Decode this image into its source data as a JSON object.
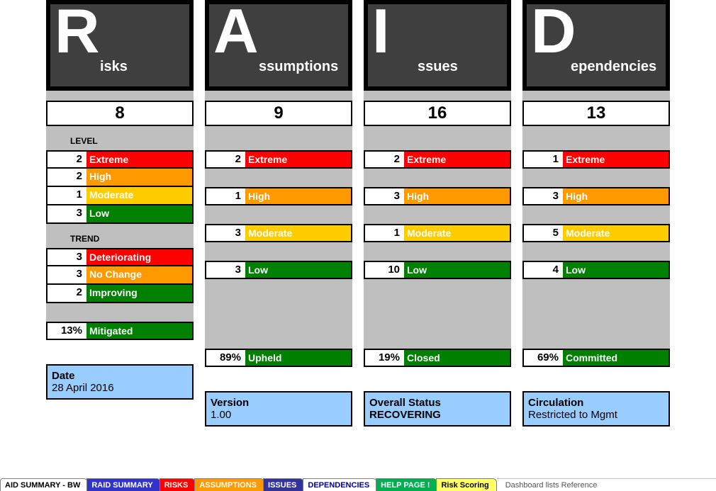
{
  "columns": [
    {
      "key": "risks",
      "bigLetter": "R",
      "rest": "isks",
      "count": "8",
      "levelHeader": "LEVEL",
      "levels": [
        {
          "n": "2",
          "label": "Extreme",
          "cls": "extreme"
        },
        {
          "n": "2",
          "label": "High",
          "cls": "high"
        },
        {
          "n": "1",
          "label": "Moderate",
          "cls": "moderate"
        },
        {
          "n": "3",
          "label": "Low",
          "cls": "low"
        }
      ],
      "levelsGapped": false,
      "trendHeader": "TREND",
      "trends": [
        {
          "n": "3",
          "label": "Deteriorating",
          "cls": "deter"
        },
        {
          "n": "3",
          "label": "No Change",
          "cls": "nochg"
        },
        {
          "n": "2",
          "label": "Improving",
          "cls": "improve"
        }
      ],
      "pct": {
        "n": "13%",
        "label": "Mitigated",
        "cls": "done"
      }
    },
    {
      "key": "assumptions",
      "bigLetter": "A",
      "rest": "ssumptions",
      "count": "9",
      "levels": [
        {
          "n": "2",
          "label": "Extreme",
          "cls": "extreme"
        },
        {
          "n": "1",
          "label": "High",
          "cls": "high"
        },
        {
          "n": "3",
          "label": "Moderate",
          "cls": "moderate"
        },
        {
          "n": "3",
          "label": "Low",
          "cls": "low"
        }
      ],
      "levelsGapped": true,
      "pct": {
        "n": "89%",
        "label": "Upheld",
        "cls": "done"
      }
    },
    {
      "key": "issues",
      "bigLetter": "I",
      "rest": "ssues",
      "count": "16",
      "levels": [
        {
          "n": "2",
          "label": "Extreme",
          "cls": "extreme"
        },
        {
          "n": "3",
          "label": "High",
          "cls": "high"
        },
        {
          "n": "1",
          "label": "Moderate",
          "cls": "moderate"
        },
        {
          "n": "10",
          "label": "Low",
          "cls": "low"
        }
      ],
      "levelsGapped": true,
      "pct": {
        "n": "19%",
        "label": "Closed",
        "cls": "done"
      }
    },
    {
      "key": "dependencies",
      "bigLetter": "D",
      "rest": "ependencies",
      "count": "13",
      "levels": [
        {
          "n": "1",
          "label": "Extreme",
          "cls": "extreme"
        },
        {
          "n": "3",
          "label": "High",
          "cls": "high"
        },
        {
          "n": "5",
          "label": "Moderate",
          "cls": "moderate"
        },
        {
          "n": "4",
          "label": "Low",
          "cls": "low"
        }
      ],
      "levelsGapped": true,
      "pct": {
        "n": "69%",
        "label": "Committed",
        "cls": "done"
      }
    }
  ],
  "infoboxes": [
    {
      "h": "Date",
      "v": "28 April 2016"
    },
    {
      "h": "Version",
      "v": "1.00"
    },
    {
      "h": "Overall Status",
      "v": "RECOVERING",
      "vBold": true
    },
    {
      "h": "Circulation",
      "v": "Restricted to Mgmt"
    }
  ],
  "tabs": [
    {
      "label": "AID SUMMARY - BW",
      "bg": "#ffffff",
      "fg": "#000000"
    },
    {
      "label": "RAID SUMMARY",
      "bg": "#3333cc",
      "fg": "#ffffff"
    },
    {
      "label": "RISKS",
      "bg": "#ff0000",
      "fg": "#ffffff"
    },
    {
      "label": "ASSUMPTIONS",
      "bg": "#ff9900",
      "fg": "#ffffff"
    },
    {
      "label": "ISSUES",
      "bg": "#333399",
      "fg": "#ffffff"
    },
    {
      "label": "DEPENDENCIES",
      "bg": "#ffffff",
      "fg": "#0000a0"
    },
    {
      "label": "HELP PAGE !",
      "bg": "#00b050",
      "fg": "#ffffff"
    },
    {
      "label": "Risk Scoring",
      "bg": "#ffff66",
      "fg": "#000000"
    }
  ],
  "tabOverflowText": "Dashboard lists Reference"
}
